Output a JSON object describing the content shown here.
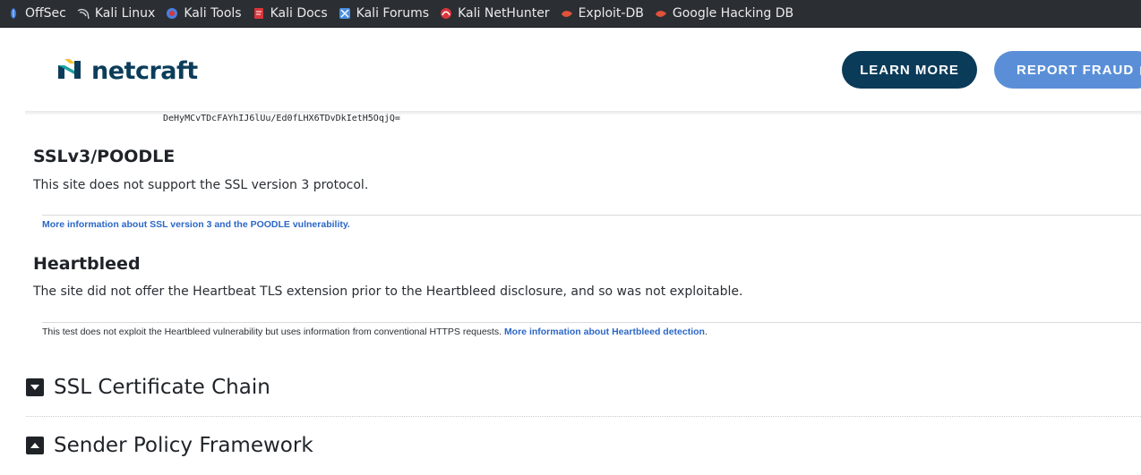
{
  "bookmarks": [
    {
      "label": "OffSec",
      "icon": "offsec-icon",
      "color": "#3f7bd9"
    },
    {
      "label": "Kali Linux",
      "icon": "kali-dragon-icon",
      "color": "#cfd3d8"
    },
    {
      "label": "Kali Tools",
      "icon": "kali-tools-icon",
      "color": "#4a7fe0"
    },
    {
      "label": "Kali Docs",
      "icon": "kali-docs-icon",
      "color": "#d8363b"
    },
    {
      "label": "Kali Forums",
      "icon": "kali-forums-icon",
      "color": "#4a8fe0"
    },
    {
      "label": "Kali NetHunter",
      "icon": "nethunter-icon",
      "color": "#d8363b"
    },
    {
      "label": "Exploit-DB",
      "icon": "exploit-db-icon",
      "color": "#e0533a"
    },
    {
      "label": "Google Hacking DB",
      "icon": "ghdb-icon",
      "color": "#e0533a"
    }
  ],
  "header": {
    "logo_text": "netcraft",
    "learn_more": "LEARN MORE",
    "report_fraud": "REPORT FRAUD"
  },
  "content": {
    "hash_text": "DeHyMCvTDcFAYhIJ6lUu/Ed0fLHX6TDvDkIetH5OqjQ=",
    "sslv3": {
      "title": "SSLv3/POODLE",
      "text": "This site does not support the SSL version 3 protocol.",
      "link": "More information about SSL version 3 and the POODLE vulnerability."
    },
    "heartbleed": {
      "title": "Heartbleed",
      "text": "The site did not offer the Heartbeat TLS extension prior to the Heartbleed disclosure, and so was not exploitable.",
      "note": "This test does not exploit the Heartbleed vulnerability but uses information from conventional HTTPS requests.",
      "link": "More information about Heartbleed detection",
      "link_suffix": "."
    },
    "sections": [
      {
        "title": "SSL Certificate Chain",
        "state": "expanded"
      },
      {
        "title": "Sender Policy Framework",
        "state": "collapsed"
      }
    ]
  },
  "colors": {
    "bookmarks_bg": "#2b2e33",
    "brand_dark": "#0a3b59",
    "brand_light": "#5a8fd8",
    "link": "#2c67c7"
  }
}
